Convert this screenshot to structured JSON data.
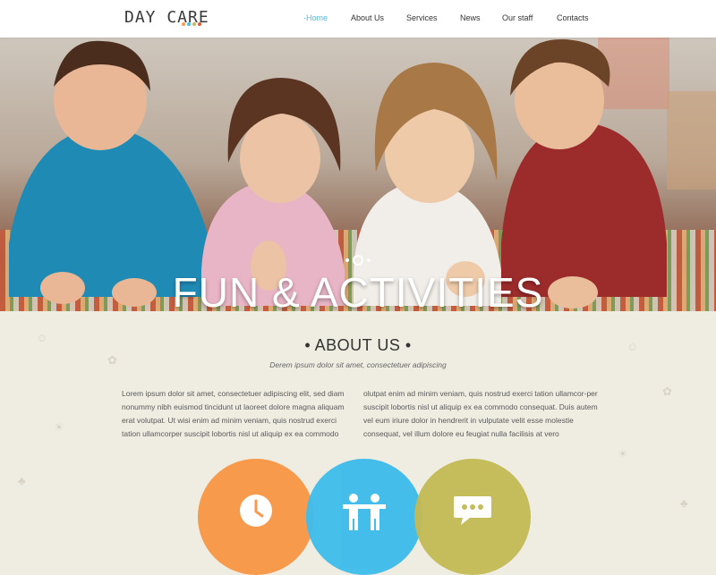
{
  "header": {
    "logo_text": "DAY CARE",
    "logo_dot_colors": [
      "#f79a4b",
      "#3fbceb",
      "#c3ba55",
      "#e0563f"
    ],
    "nav": [
      {
        "label": "Home",
        "active": true
      },
      {
        "label": "About Us",
        "active": false
      },
      {
        "label": "Services",
        "active": false
      },
      {
        "label": "News",
        "active": false
      },
      {
        "label": "Our staff",
        "active": false
      },
      {
        "label": "Contacts",
        "active": false
      }
    ]
  },
  "hero": {
    "title": "FUN & ACTIVITIES"
  },
  "about": {
    "title": "ABOUT US",
    "subtitle": "Derem ipsum dolor sit amet, consectetuer adipiscing",
    "col_left": "Lorem ipsum dolor sit amet, consectetuer adipiscing elit, sed diam nonummy nibh euismod tincidunt ut laoreet dolore magna aliquam erat volutpat. Ut wisi enim ad minim veniam, quis nostrud exerci tation ullamcorper suscipit lobortis nisl ut aliquip ex ea commodo",
    "col_right": "olutpat enim ad minim veniam, quis nostrud exerci tation ullamcor-per suscipit lobortis nisl ut aliquip ex ea commodo consequat. Duis autem vel eum iriure dolor in hendrerit in vulputate velit esse molestie consequat, vel illum dolore eu feugiat nulla facilisis at vero"
  },
  "features": [
    {
      "icon": "clock-icon",
      "color": "#f79a4b"
    },
    {
      "icon": "people-icon",
      "color": "#3fbceb"
    },
    {
      "icon": "chat-icon",
      "color": "#c3ba55"
    }
  ],
  "colors": {
    "accent_blue": "#4fb9e3",
    "background": "#efece2"
  }
}
